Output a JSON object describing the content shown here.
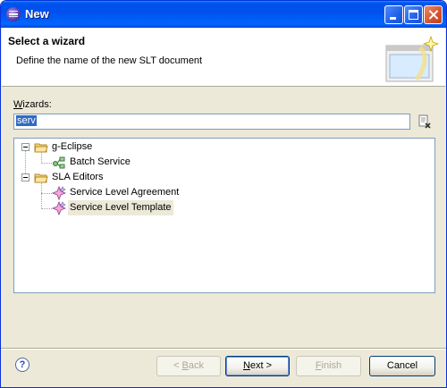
{
  "window": {
    "title": "New"
  },
  "header": {
    "title": "Select a wizard",
    "description": "Define the name of the new SLT document"
  },
  "wizards": {
    "label_mnemonic": "W",
    "label_rest": "izards:",
    "filter_value": "serv"
  },
  "tree": {
    "items": [
      {
        "label": "g-Eclipse",
        "type": "category",
        "expanded": true,
        "icon": "folder-icon"
      },
      {
        "label": "Batch Service",
        "type": "wizard",
        "icon": "batch-service-icon"
      },
      {
        "label": "SLA Editors",
        "type": "category",
        "expanded": true,
        "icon": "folder-icon"
      },
      {
        "label": "Service Level Agreement",
        "type": "wizard",
        "icon": "sla-icon"
      },
      {
        "label": "Service Level Template",
        "type": "wizard",
        "icon": "slt-icon",
        "selected": true
      }
    ]
  },
  "buttons": {
    "back_prefix": "< ",
    "back_mnemonic": "B",
    "back_rest": "ack",
    "next_mnemonic": "N",
    "next_rest": "ext >",
    "finish_mnemonic": "F",
    "finish_rest": "inish",
    "cancel": "Cancel"
  },
  "colors": {
    "titlebar": "#0055e5",
    "dialog_bg": "#ece9d8",
    "selection": "#316ac5"
  }
}
